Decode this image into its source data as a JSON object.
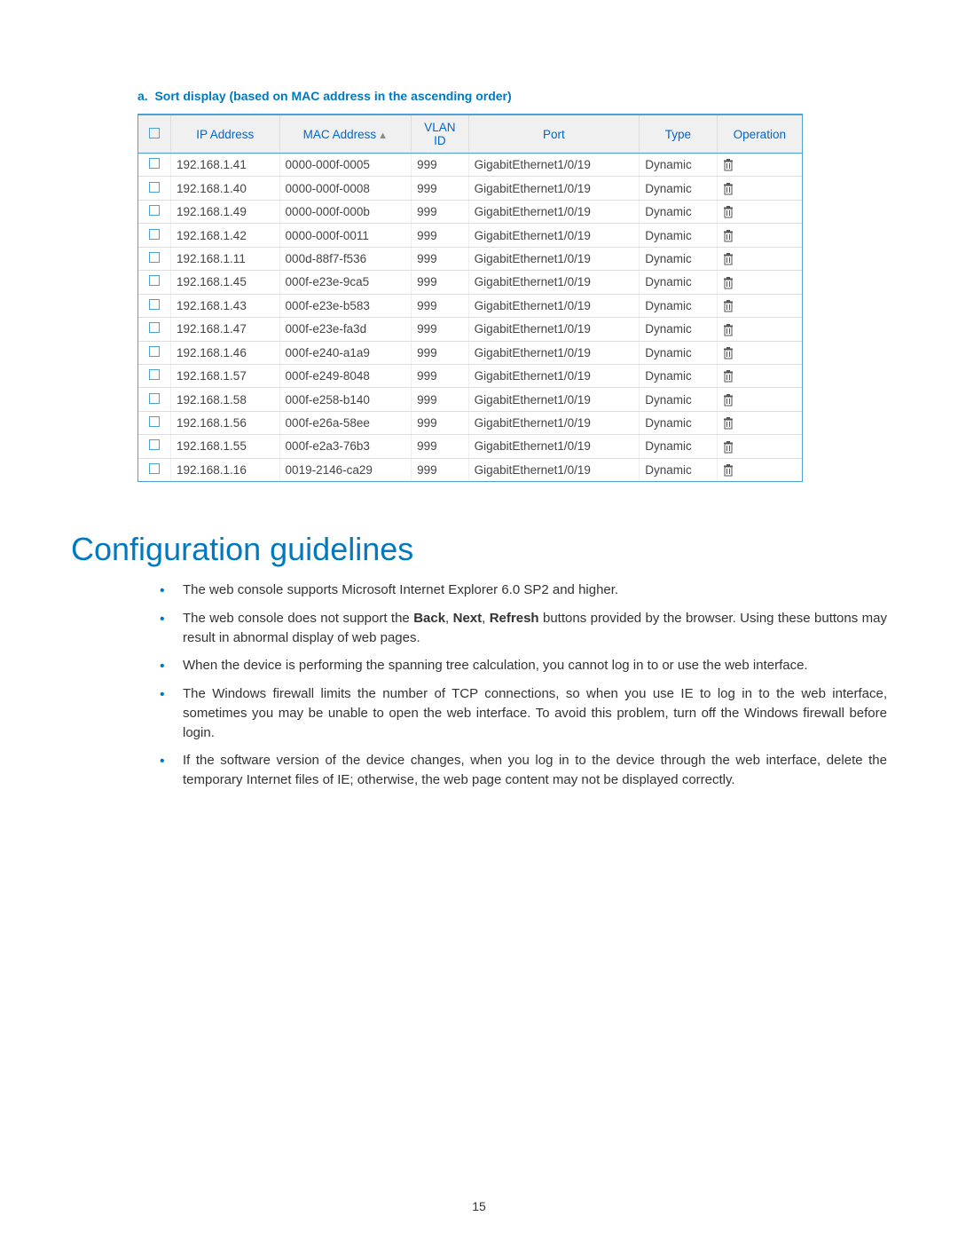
{
  "caption": {
    "prefix": "a.",
    "text": "Sort display (based on MAC address in the ascending order)"
  },
  "table": {
    "headers": {
      "ip": "IP Address",
      "mac": "MAC Address",
      "vlan_line1": "VLAN",
      "vlan_line2": "ID",
      "port": "Port",
      "type": "Type",
      "operation": "Operation"
    },
    "rows": [
      {
        "ip": "192.168.1.41",
        "mac": "0000-000f-0005",
        "vlan": "999",
        "port": "GigabitEthernet1/0/19",
        "type": "Dynamic"
      },
      {
        "ip": "192.168.1.40",
        "mac": "0000-000f-0008",
        "vlan": "999",
        "port": "GigabitEthernet1/0/19",
        "type": "Dynamic"
      },
      {
        "ip": "192.168.1.49",
        "mac": "0000-000f-000b",
        "vlan": "999",
        "port": "GigabitEthernet1/0/19",
        "type": "Dynamic"
      },
      {
        "ip": "192.168.1.42",
        "mac": "0000-000f-0011",
        "vlan": "999",
        "port": "GigabitEthernet1/0/19",
        "type": "Dynamic"
      },
      {
        "ip": "192.168.1.11",
        "mac": "000d-88f7-f536",
        "vlan": "999",
        "port": "GigabitEthernet1/0/19",
        "type": "Dynamic"
      },
      {
        "ip": "192.168.1.45",
        "mac": "000f-e23e-9ca5",
        "vlan": "999",
        "port": "GigabitEthernet1/0/19",
        "type": "Dynamic"
      },
      {
        "ip": "192.168.1.43",
        "mac": "000f-e23e-b583",
        "vlan": "999",
        "port": "GigabitEthernet1/0/19",
        "type": "Dynamic"
      },
      {
        "ip": "192.168.1.47",
        "mac": "000f-e23e-fa3d",
        "vlan": "999",
        "port": "GigabitEthernet1/0/19",
        "type": "Dynamic"
      },
      {
        "ip": "192.168.1.46",
        "mac": "000f-e240-a1a9",
        "vlan": "999",
        "port": "GigabitEthernet1/0/19",
        "type": "Dynamic"
      },
      {
        "ip": "192.168.1.57",
        "mac": "000f-e249-8048",
        "vlan": "999",
        "port": "GigabitEthernet1/0/19",
        "type": "Dynamic"
      },
      {
        "ip": "192.168.1.58",
        "mac": "000f-e258-b140",
        "vlan": "999",
        "port": "GigabitEthernet1/0/19",
        "type": "Dynamic"
      },
      {
        "ip": "192.168.1.56",
        "mac": "000f-e26a-58ee",
        "vlan": "999",
        "port": "GigabitEthernet1/0/19",
        "type": "Dynamic"
      },
      {
        "ip": "192.168.1.55",
        "mac": "000f-e2a3-76b3",
        "vlan": "999",
        "port": "GigabitEthernet1/0/19",
        "type": "Dynamic"
      },
      {
        "ip": "192.168.1.16",
        "mac": "0019-2146-ca29",
        "vlan": "999",
        "port": "GigabitEthernet1/0/19",
        "type": "Dynamic"
      }
    ]
  },
  "section_title": "Configuration guidelines",
  "guidelines": [
    [
      {
        "t": "The web console supports Microsoft Internet Explorer 6.0 SP2 and higher."
      }
    ],
    [
      {
        "t": "The web console does not support the "
      },
      {
        "t": "Back",
        "b": true
      },
      {
        "t": ", "
      },
      {
        "t": "Next",
        "b": true
      },
      {
        "t": ", "
      },
      {
        "t": "Refresh",
        "b": true
      },
      {
        "t": " buttons provided by the browser. Using these buttons may result in abnormal display of web pages."
      }
    ],
    [
      {
        "t": "When the device is performing the spanning tree calculation, you cannot log in to or use the web interface."
      }
    ],
    [
      {
        "t": "The Windows firewall limits the number of TCP connections, so when you use IE to log in to the web interface, sometimes you may be unable to open the web interface. To avoid this problem, turn off the Windows firewall before login."
      }
    ],
    [
      {
        "t": "If the software version of the device changes, when you log in to the device through the web interface, delete the temporary Internet files of IE; otherwise, the web page content may not be displayed correctly."
      }
    ]
  ],
  "page_number": "15"
}
